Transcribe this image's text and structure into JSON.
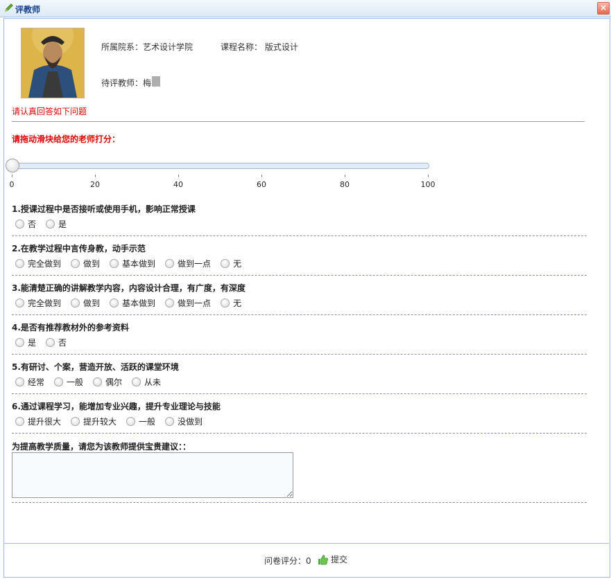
{
  "window": {
    "title": "评教师",
    "close_glyph": "×"
  },
  "header": {
    "dept_label": "所属院系：艺术设计学院",
    "course_label": "课程名称：  版式设计",
    "teacher_label": "待评教师：梅",
    "notice": "请认真回答如下问题"
  },
  "slider": {
    "prompt": "请拖动滑块给您的老师打分：",
    "value": 0,
    "min": 0,
    "max": 100,
    "ticks": [
      "0",
      "20",
      "40",
      "60",
      "80",
      "100"
    ]
  },
  "questions": [
    {
      "title": "1.授课过程中是否接听或使用手机，影响正常授课",
      "options": [
        "否",
        "是"
      ]
    },
    {
      "title": "2.在教学过程中言传身教，动手示范",
      "options": [
        "完全做到",
        "做到",
        "基本做到",
        "做到一点",
        "无"
      ]
    },
    {
      "title": "3.能清楚正确的讲解教学内容，内容设计合理，有广度，有深度",
      "options": [
        "完全做到",
        "做到",
        "基本做到",
        "做到一点",
        "无"
      ]
    },
    {
      "title": "4.是否有推荐教材外的参考资料",
      "options": [
        "是",
        "否"
      ]
    },
    {
      "title": "5.有研讨、个案，营造开放、活跃的课堂环境",
      "options": [
        "经常",
        "一般",
        "偶尔",
        "从未"
      ]
    },
    {
      "title": "6.通过课程学习，能增加专业兴趣，提升专业理论与技能",
      "options": [
        "提升很大",
        "提升较大",
        "一般",
        "没做到"
      ]
    }
  ],
  "suggestion": {
    "label": "为提高教学质量，请您为该教师提供宝贵建议：：",
    "value": ""
  },
  "footer": {
    "score_label": "问卷评分：0",
    "submit_label": "提交"
  },
  "colors": {
    "accent": "#15428b",
    "warning": "#e00000",
    "border": "#99bbe8"
  },
  "icons": {
    "title": "pencil-icon",
    "submit": "thumbs-up-icon",
    "close": "close-icon"
  }
}
